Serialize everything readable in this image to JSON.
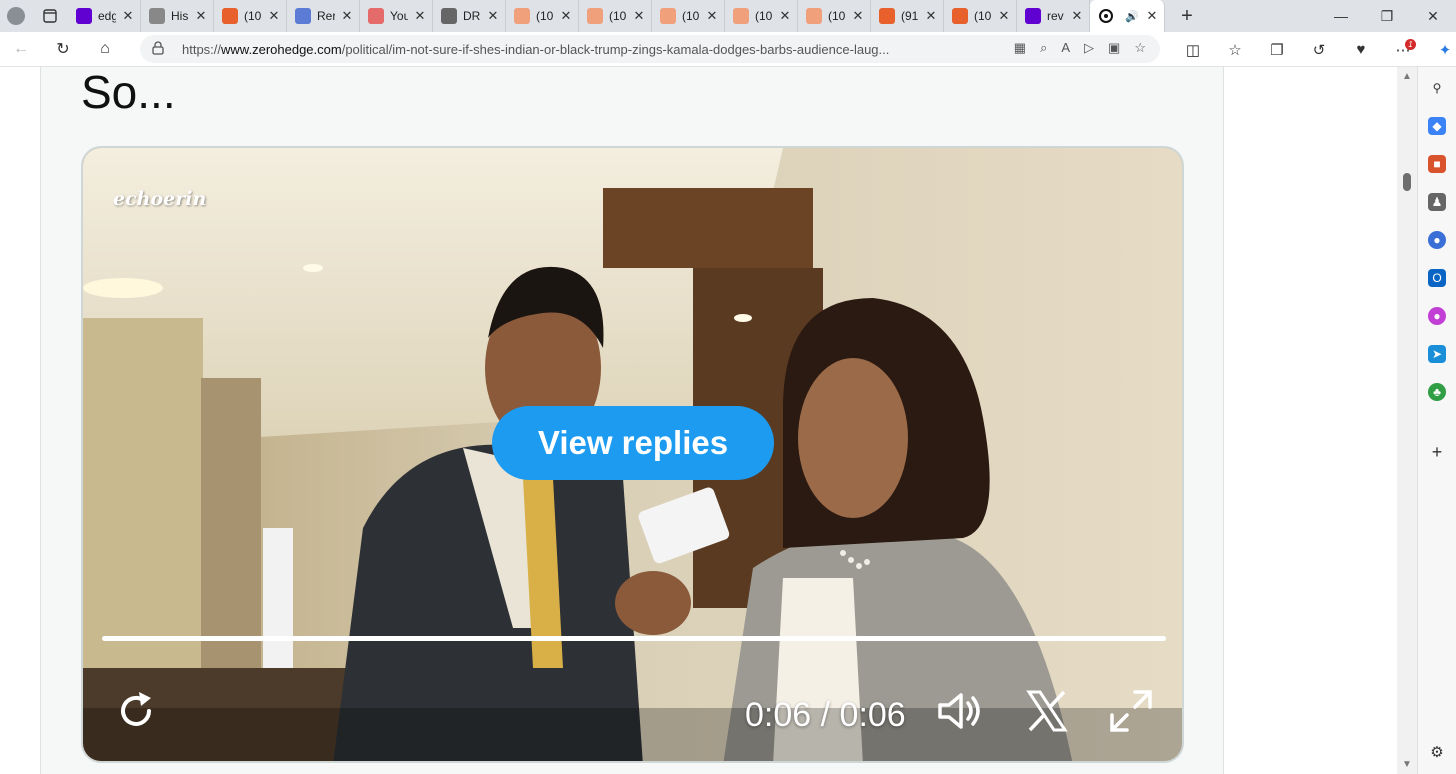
{
  "tabs": [
    {
      "title": "edg",
      "favicon": "yahoo-icon",
      "color": "#6001d2"
    },
    {
      "title": "His",
      "favicon": "history-icon",
      "color": "#888888"
    },
    {
      "title": "(10",
      "favicon": "substack-icon",
      "color": "#e8612c"
    },
    {
      "title": "Rer",
      "favicon": "link-icon",
      "color": "#5b7bd5"
    },
    {
      "title": "You",
      "favicon": "youtube-icon",
      "color": "#e56b6b"
    },
    {
      "title": "DR",
      "favicon": "drudge-icon",
      "color": "#666666"
    },
    {
      "title": "(10",
      "favicon": "substack-icon",
      "color": "#f0a07a"
    },
    {
      "title": "(10",
      "favicon": "substack-icon",
      "color": "#f0a07a"
    },
    {
      "title": "(10",
      "favicon": "substack-icon",
      "color": "#f0a07a"
    },
    {
      "title": "(10",
      "favicon": "substack-icon",
      "color": "#f0a07a"
    },
    {
      "title": "(10",
      "favicon": "substack-icon",
      "color": "#f0a07a"
    },
    {
      "title": "(91",
      "favicon": "substack-icon",
      "color": "#e8612c"
    },
    {
      "title": "(10",
      "favicon": "substack-icon",
      "color": "#e8612c"
    },
    {
      "title": "rev",
      "favicon": "yahoo-icon",
      "color": "#6001d2"
    },
    {
      "title": "",
      "favicon": "zerohedge-icon",
      "color": "#111111",
      "active": true
    }
  ],
  "address": {
    "prefix": "https://",
    "host": "www.zerohedge.com",
    "path": "/political/im-not-sure-if-shes-indian-or-black-trump-zings-kamala-dodges-barbs-audience-laug..."
  },
  "article": {
    "heading": "So..."
  },
  "video": {
    "watermark": "echoerin",
    "view_replies_label": "View replies",
    "current_time": "0:06",
    "separator": " / ",
    "duration": "0:06",
    "progress": 1.0
  },
  "colors": {
    "accent": "#1d9bf0"
  }
}
